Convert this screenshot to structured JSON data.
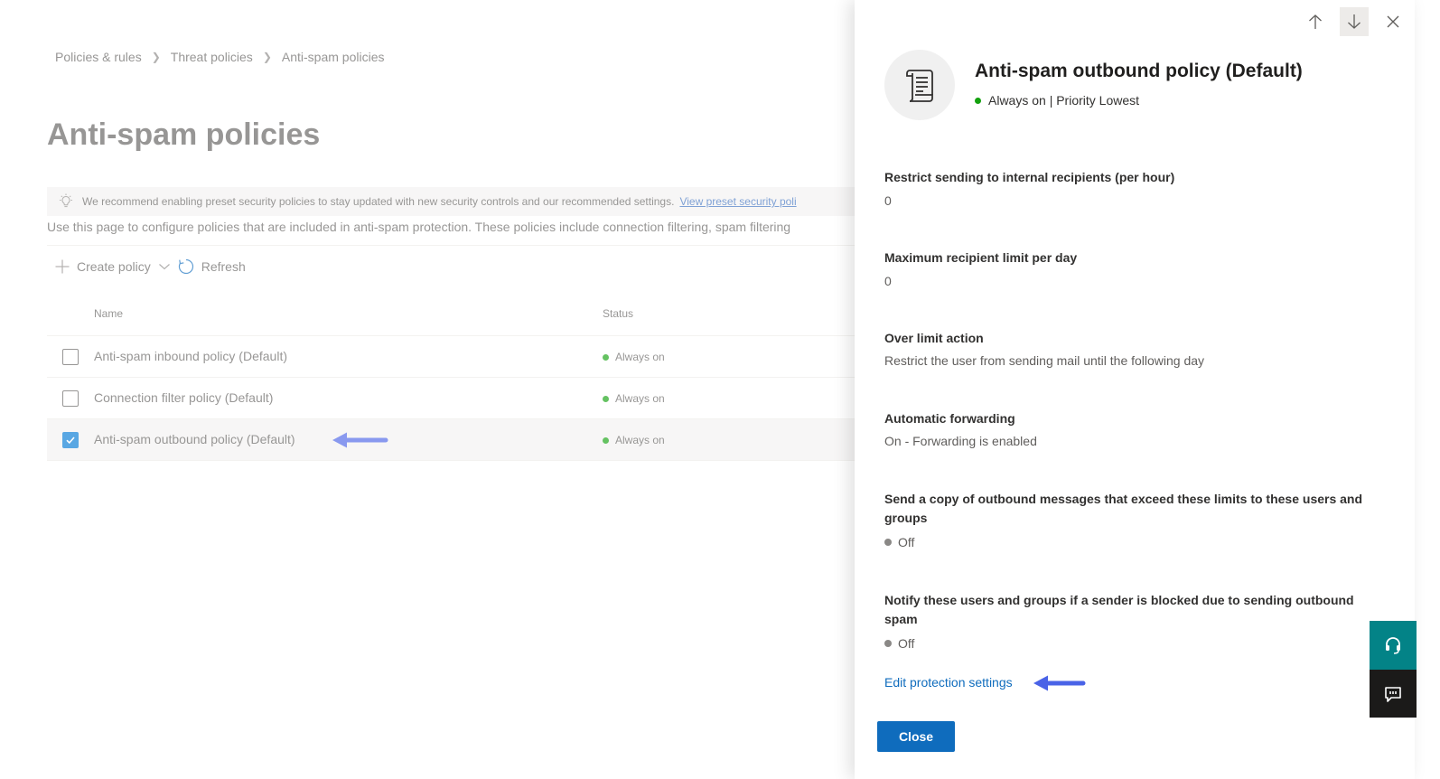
{
  "breadcrumb": {
    "items": [
      "Policies & rules",
      "Threat policies",
      "Anti-spam policies"
    ]
  },
  "page": {
    "title": "Anti-spam policies",
    "banner_text": "We recommend enabling preset security policies to stay updated with new security controls and our recommended settings.",
    "banner_link": "View preset security poli",
    "description": "Use this page to configure policies that are included in anti-spam protection. These policies include connection filtering, spam filtering"
  },
  "toolbar": {
    "create_label": "Create policy",
    "refresh_label": "Refresh"
  },
  "table": {
    "headers": {
      "name": "Name",
      "status": "Status"
    },
    "rows": [
      {
        "name": "Anti-spam inbound policy (Default)",
        "status": "Always on",
        "selected": false
      },
      {
        "name": "Connection filter policy (Default)",
        "status": "Always on",
        "selected": false
      },
      {
        "name": "Anti-spam outbound policy (Default)",
        "status": "Always on",
        "selected": true
      }
    ]
  },
  "panel": {
    "title": "Anti-spam outbound policy (Default)",
    "subtitle": "Always on | Priority Lowest",
    "fields": [
      {
        "label": "Restrict sending to internal recipients (per hour)",
        "value": "0"
      },
      {
        "label": "Maximum recipient limit per day",
        "value": "0"
      },
      {
        "label": "Over limit action",
        "value": "Restrict the user from sending mail until the following day"
      },
      {
        "label": "Automatic forwarding",
        "value": "On - Forwarding is enabled"
      },
      {
        "label": "Send a copy of outbound messages that exceed these limits to these users and groups",
        "value": "Off"
      },
      {
        "label": "Notify these users and groups if a sender is blocked due to sending outbound spam",
        "value": "Off"
      }
    ],
    "edit_link": "Edit protection settings",
    "close_label": "Close"
  },
  "icons": {
    "nav_up": "arrow-up-icon",
    "nav_down": "arrow-down-icon",
    "dismiss": "close-icon",
    "policy": "scroll-document-icon",
    "help": "headset-help-icon",
    "feedback": "feedback-icon"
  },
  "colors": {
    "accent": "#0f6cbd",
    "status_on": "#13a10e",
    "status_off": "#8a8886",
    "annotation_arrow": "#4a63e7",
    "help_button": "#038387"
  }
}
